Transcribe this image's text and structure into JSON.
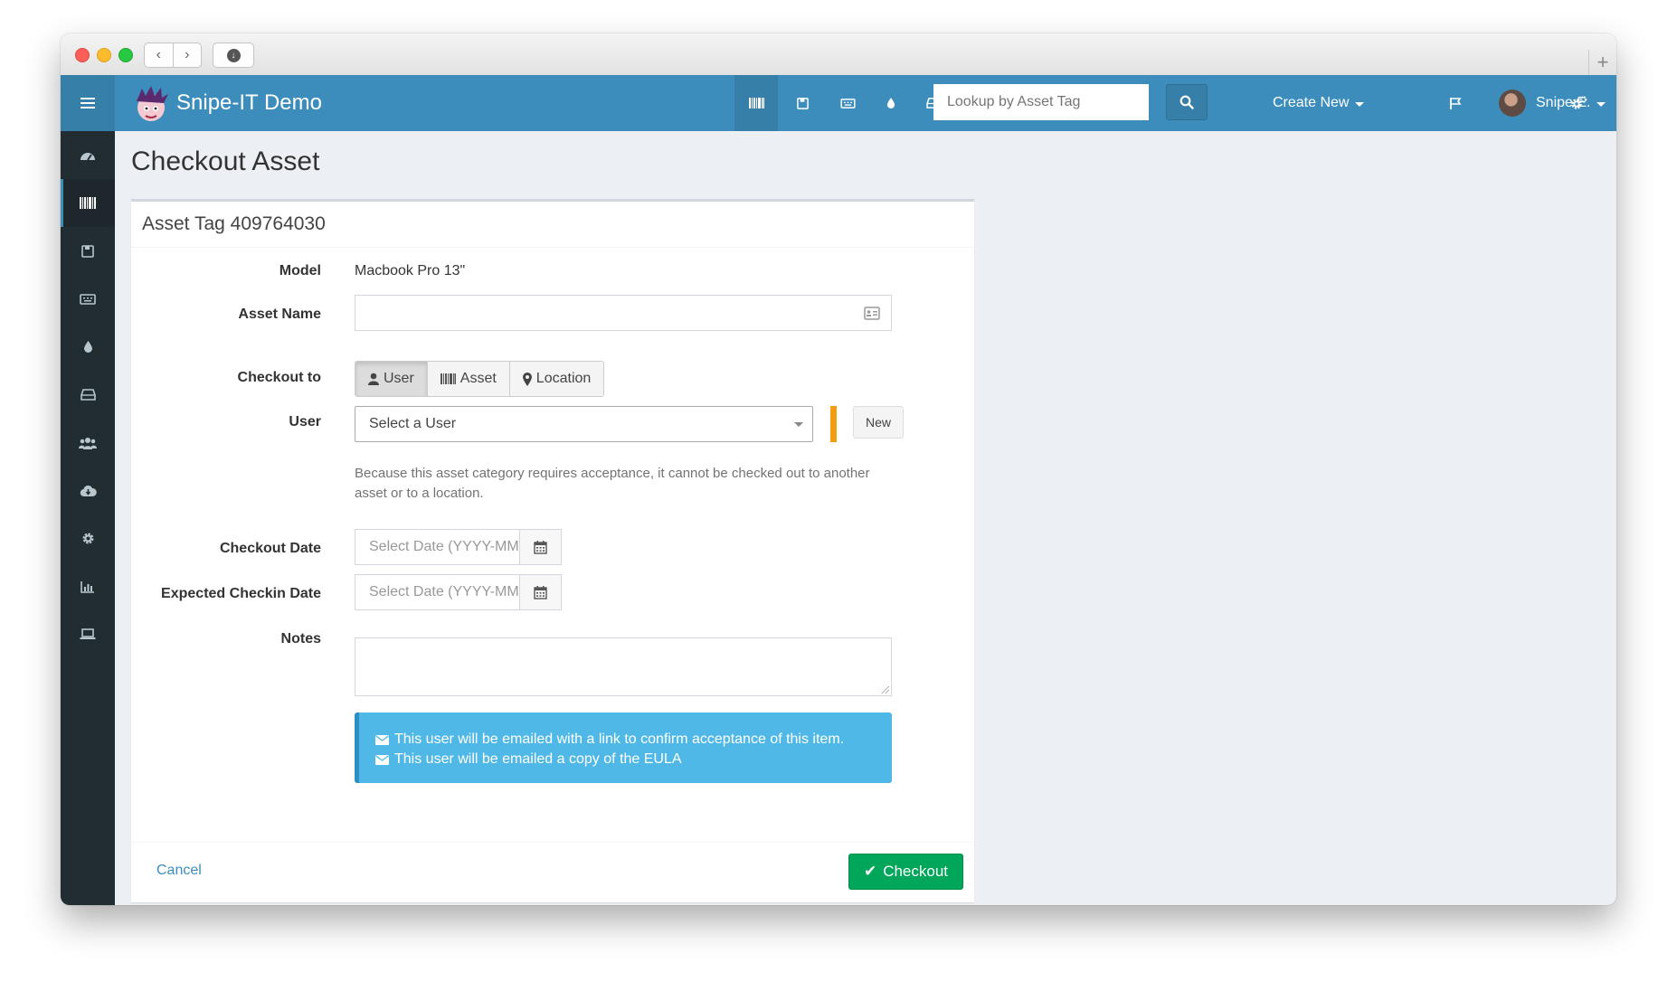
{
  "app": {
    "brand": "Snipe-IT Demo"
  },
  "topbar": {
    "search_placeholder": "Lookup by Asset Tag",
    "create_new": "Create New",
    "user_name": "Snipe E."
  },
  "page": {
    "title": "Checkout Asset"
  },
  "form": {
    "header": "Asset Tag 409764030",
    "model_label": "Model",
    "model_value": "Macbook Pro 13\"",
    "asset_name_label": "Asset Name",
    "checkout_to_label": "Checkout to",
    "checkout_to_options": [
      "User",
      "Asset",
      "Location"
    ],
    "checkout_to_selected": "User",
    "user_label": "User",
    "user_select_value": "Select a User",
    "new_button": "New",
    "help_text": "Because this asset category requires acceptance, it cannot be checked out to another asset or to a location.",
    "checkout_date_label": "Checkout Date",
    "checkout_date_placeholder": "Select Date (YYYY-MM-DD)",
    "expected_checkin_label": "Expected Checkin Date",
    "expected_checkin_placeholder": "Select Date (YYYY-MM-DD)",
    "notes_label": "Notes",
    "callout_lines": [
      "This user will be emailed with a link to confirm acceptance of this item.",
      "This user will be emailed a copy of the EULA"
    ],
    "cancel": "Cancel",
    "submit": "Checkout"
  },
  "colors": {
    "header_blue": "#3c8dbc",
    "sidebar_dark": "#222d32",
    "success_green": "#00a65a",
    "info_blue": "#50b8e6",
    "required_orange": "#f39c12"
  }
}
